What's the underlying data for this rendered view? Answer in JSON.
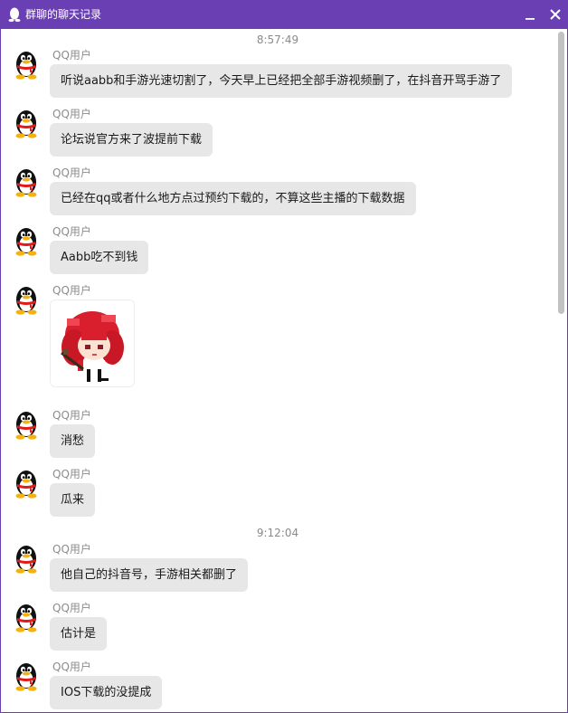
{
  "window": {
    "title": "群聊的聊天记录",
    "accent_color": "#6a3fb3",
    "title_icon": "qq-penguin-icon",
    "controls": [
      "minimize-icon",
      "close-icon"
    ]
  },
  "messages_area": {
    "timestamps": [
      "8:57:49",
      "9:12:04"
    ],
    "messages": [
      {
        "sender": "QQ用户",
        "avatar": "qq-penguin-avatar",
        "text": "听说aabb和手游光速切割了，今天早上已经把全部手游视频删了，在抖音开骂手游了"
      },
      {
        "sender": "QQ用户",
        "avatar": "qq-penguin-avatar",
        "text": "论坛说官方来了波提前下载"
      },
      {
        "sender": "QQ用户",
        "avatar": "qq-penguin-avatar",
        "text": "已经在qq或者什么地方点过预约下载的，不算这些主播的下载数据"
      },
      {
        "sender": "QQ用户",
        "avatar": "qq-penguin-avatar",
        "text": "Aabb吃不到钱"
      },
      {
        "sender": "QQ用户",
        "avatar": "qq-penguin-avatar",
        "image": "pixel-anime-girl-sticker"
      },
      {
        "sender": "QQ用户",
        "avatar": "qq-penguin-avatar",
        "text": "消愁"
      },
      {
        "sender": "QQ用户",
        "avatar": "qq-penguin-avatar",
        "text": "瓜来"
      },
      {
        "sender": "QQ用户",
        "avatar": "qq-penguin-avatar",
        "text": "他自己的抖音号，手游相关都删了"
      },
      {
        "sender": "QQ用户",
        "avatar": "qq-penguin-avatar",
        "text": "估计是"
      },
      {
        "sender": "QQ用户",
        "avatar": "qq-penguin-avatar",
        "text": "IOS下载的没提成"
      }
    ]
  }
}
